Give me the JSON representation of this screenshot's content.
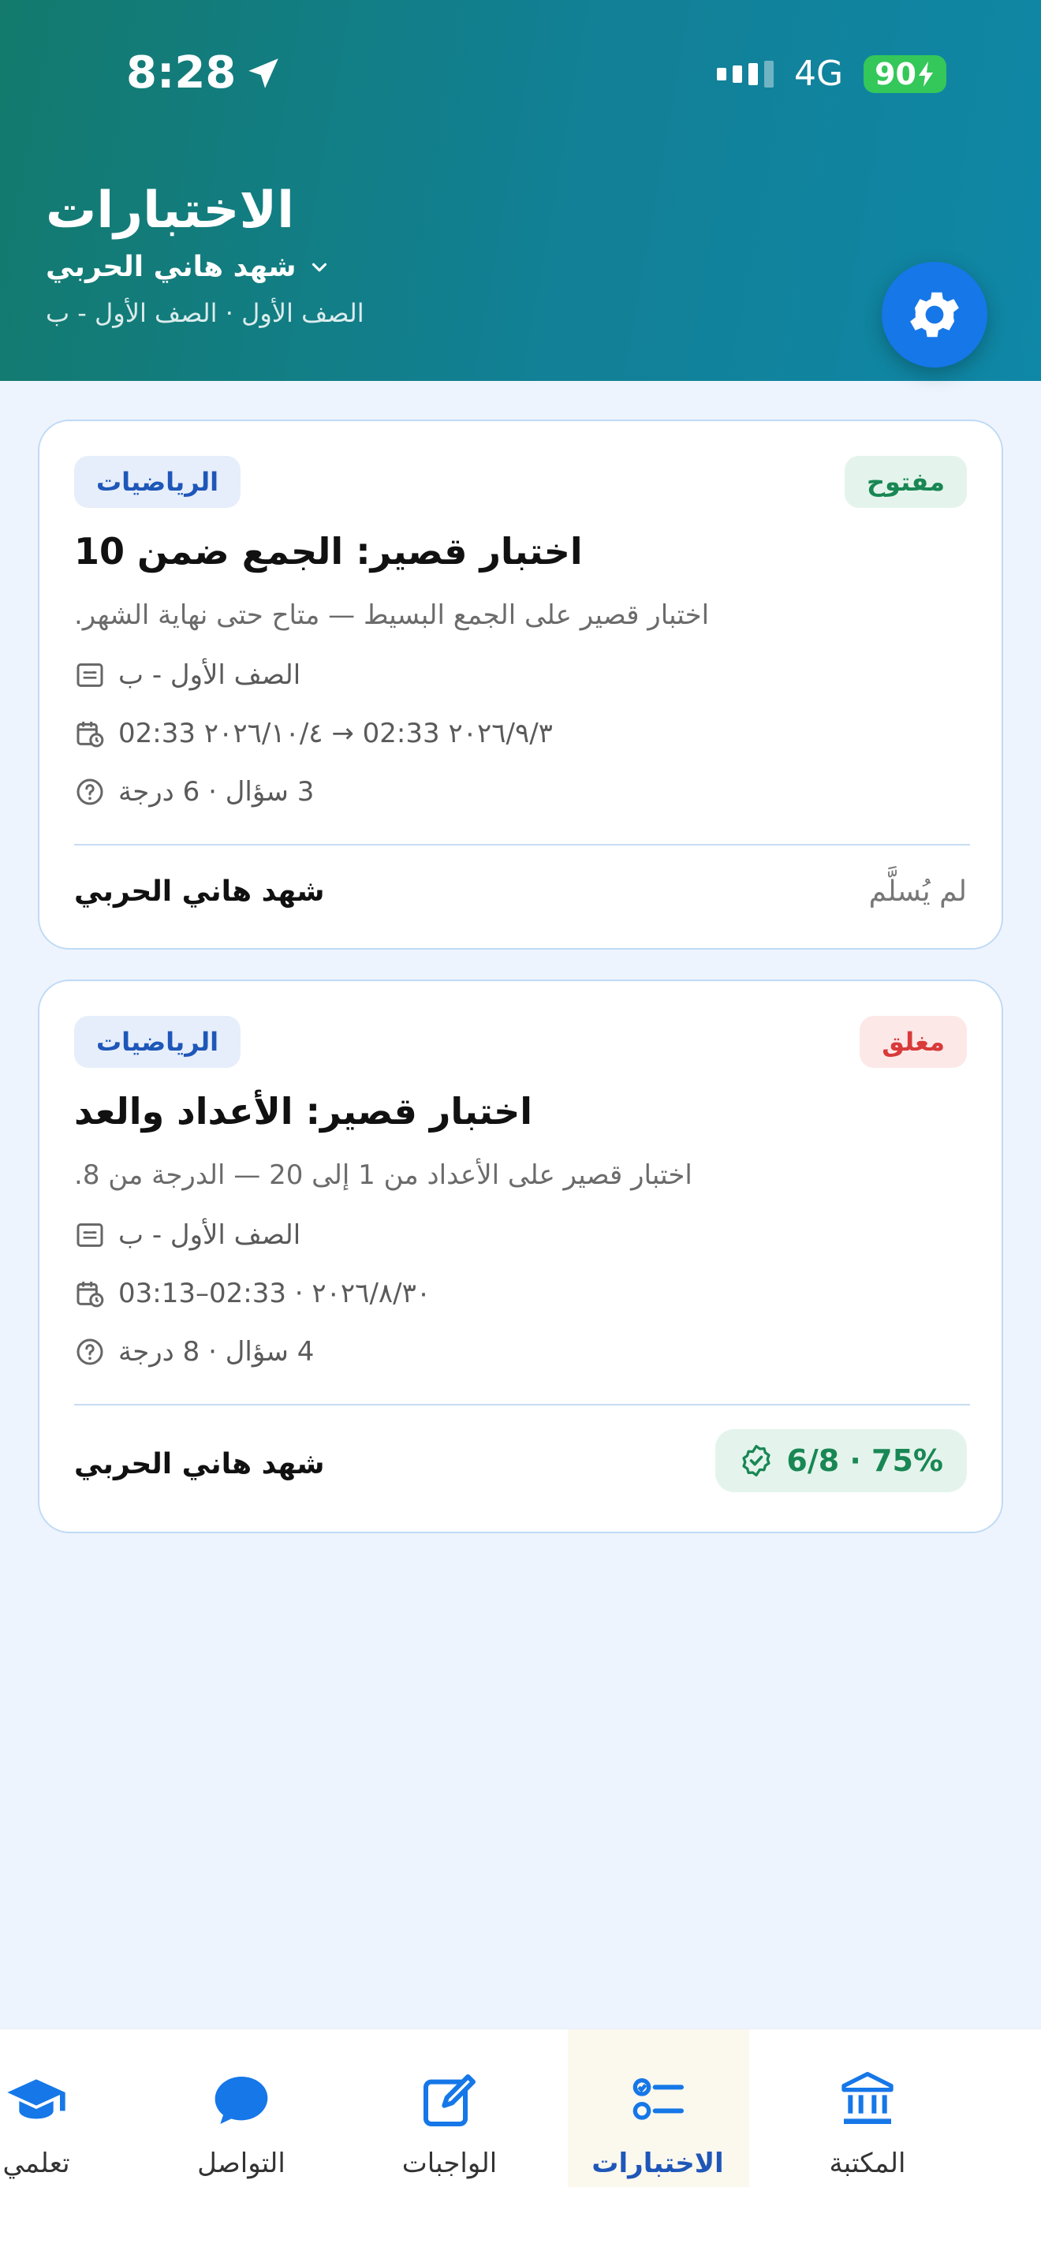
{
  "status_bar": {
    "time": "8:28",
    "network": "4G",
    "battery": "90"
  },
  "header": {
    "title": "الاختبارات",
    "student_name": "شهد هاني الحربي",
    "class_line": "الصف الأول · الصف الأول - ب"
  },
  "colors": {
    "primary": "#1677E8",
    "header_start": "#137a6d",
    "header_end": "#0f87a6",
    "open": "#198754",
    "closed": "#D93A3A"
  },
  "quizzes": [
    {
      "subject": "الرياضيات",
      "status": "مفتوح",
      "title": "اختبار قصير: الجمع ضمن 10",
      "description": "اختبار قصير على الجمع البسيط — متاح حتى نهاية الشهر.",
      "class": "الصف الأول - ب",
      "date_range": "02:33 ٢٠٢٦/١٠/٤ → 02:33 ٢٠٢٦/٩/٣",
      "questions": "3 سؤال · 6 درجة",
      "student": "شهد هاني الحربي",
      "submission": "لم يُسلَّم"
    },
    {
      "subject": "الرياضيات",
      "status": "مغلق",
      "title": "اختبار قصير: الأعداد والعد",
      "description": "اختبار قصير على الأعداد من 1 إلى 20 — الدرجة من 8.",
      "class": "الصف الأول - ب",
      "date_range": "03:13–02:33 · ٢٠٢٦/٨/٣٠",
      "questions": "4 سؤال · 8 درجة",
      "student": "شهد هاني الحربي",
      "score": "6/8 · 75%"
    }
  ],
  "nav": [
    {
      "label": "تعلمي",
      "icon": "graduation-cap-icon"
    },
    {
      "label": "التواصل",
      "icon": "chat-bubble-icon"
    },
    {
      "label": "الواجبات",
      "icon": "pencil-square-icon"
    },
    {
      "label": "الاختبارات",
      "icon": "checklist-icon",
      "active": true
    },
    {
      "label": "المكتبة",
      "icon": "library-icon"
    }
  ]
}
